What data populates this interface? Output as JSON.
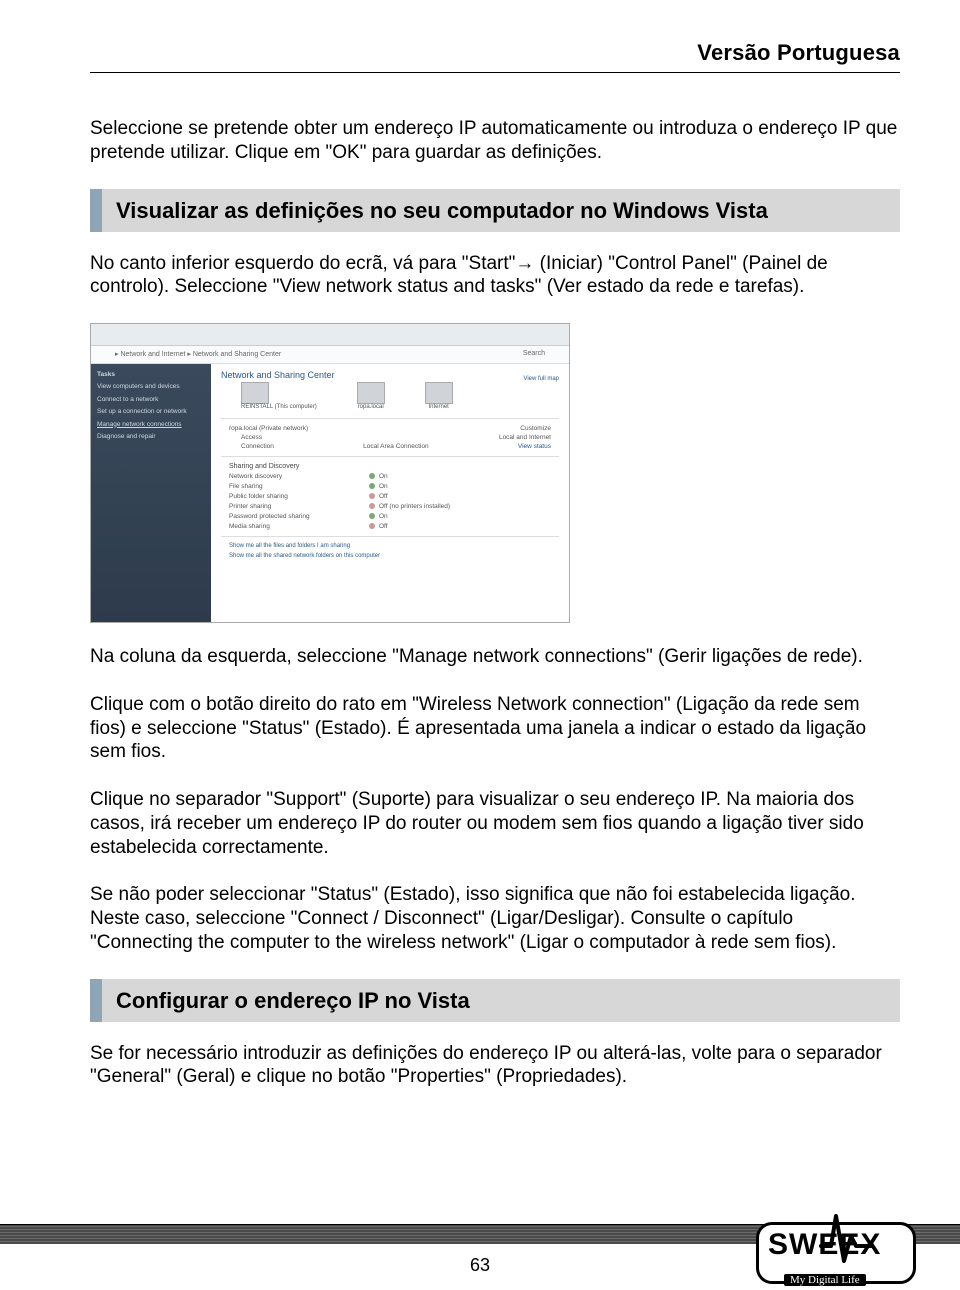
{
  "header": {
    "title": "Versão Portuguesa"
  },
  "intro_para": "Seleccione se pretende obter um endereço IP automaticamente ou introduza o endereço IP que pretende utilizar. Clique em \"OK\" para guardar as definições.",
  "section1": {
    "title": "Visualizar as definições no seu computador no Windows Vista",
    "p1_a": "No canto inferior esquerdo do ecrã, vá para \"Start\"",
    "p1_b": " (Iniciar) \"Control Panel\" (Painel de controlo). Seleccione \"View network status and tasks\" (Ver estado da rede e tarefas)."
  },
  "screenshot": {
    "addr": "▸ Network and Internet ▸ Network and Sharing Center",
    "search": "Search",
    "side": {
      "tasks": "Tasks",
      "i1": "View computers and devices",
      "i2": "Connect to a network",
      "i3": "Set up a connection or network",
      "i4": "Manage network connections",
      "i5": "Diagnose and repair"
    },
    "main": {
      "title": "Network and Sharing Center",
      "viewmap": "View full map",
      "node1": "REINSTALL (This computer)",
      "node2": "ropa.local",
      "node3": "Internet",
      "netname": "ropa.local (Private network)",
      "customize": "Customize",
      "access_l": "Access",
      "access_v": "Local and Internet",
      "conn_l": "Connection",
      "conn_v": "Local Area Connection",
      "viewstatus": "View status",
      "sharing": "Sharing and Discovery",
      "rows": [
        {
          "l": "Network discovery",
          "v": "On",
          "on": true
        },
        {
          "l": "File sharing",
          "v": "On",
          "on": true
        },
        {
          "l": "Public folder sharing",
          "v": "Off",
          "on": false
        },
        {
          "l": "Printer sharing",
          "v": "Off (no printers installed)",
          "on": false
        },
        {
          "l": "Password protected sharing",
          "v": "On",
          "on": true
        },
        {
          "l": "Media sharing",
          "v": "Off",
          "on": false
        }
      ],
      "foot1": "Show me all the files and folders I am sharing",
      "foot2": "Show me all the shared network folders on this computer"
    }
  },
  "after": {
    "p1": "Na coluna da esquerda, seleccione \"Manage network connections\" (Gerir ligações de rede).",
    "p2": "Clique com o botão direito do rato em \"Wireless Network connection\" (Ligação da rede sem fios) e seleccione \"Status\" (Estado). É apresentada uma janela a indicar o estado da ligação sem fios.",
    "p3": "Clique no separador \"Support\" (Suporte) para visualizar o seu endereço IP. Na maioria dos casos, irá receber um endereço IP do router ou modem sem fios quando a ligação tiver sido estabelecida correctamente.",
    "p4": "Se não poder seleccionar \"Status\" (Estado), isso significa que não foi estabelecida ligação. Neste caso, seleccione \"Connect / Disconnect\" (Ligar/Desligar). Consulte o capítulo \"Connecting the computer to the wireless network\" (Ligar o computador à rede sem fios)."
  },
  "section2": {
    "title": "Configurar o endereço IP no Vista",
    "p1": "Se for necessário introduzir as definições do endereço IP ou alterá-las, volte para o separador \"General\" (Geral) e clique no botão \"Properties\" (Propriedades)."
  },
  "footer": {
    "page": "63",
    "brand": "SWEEX",
    "tagline": "My Digital Life"
  }
}
